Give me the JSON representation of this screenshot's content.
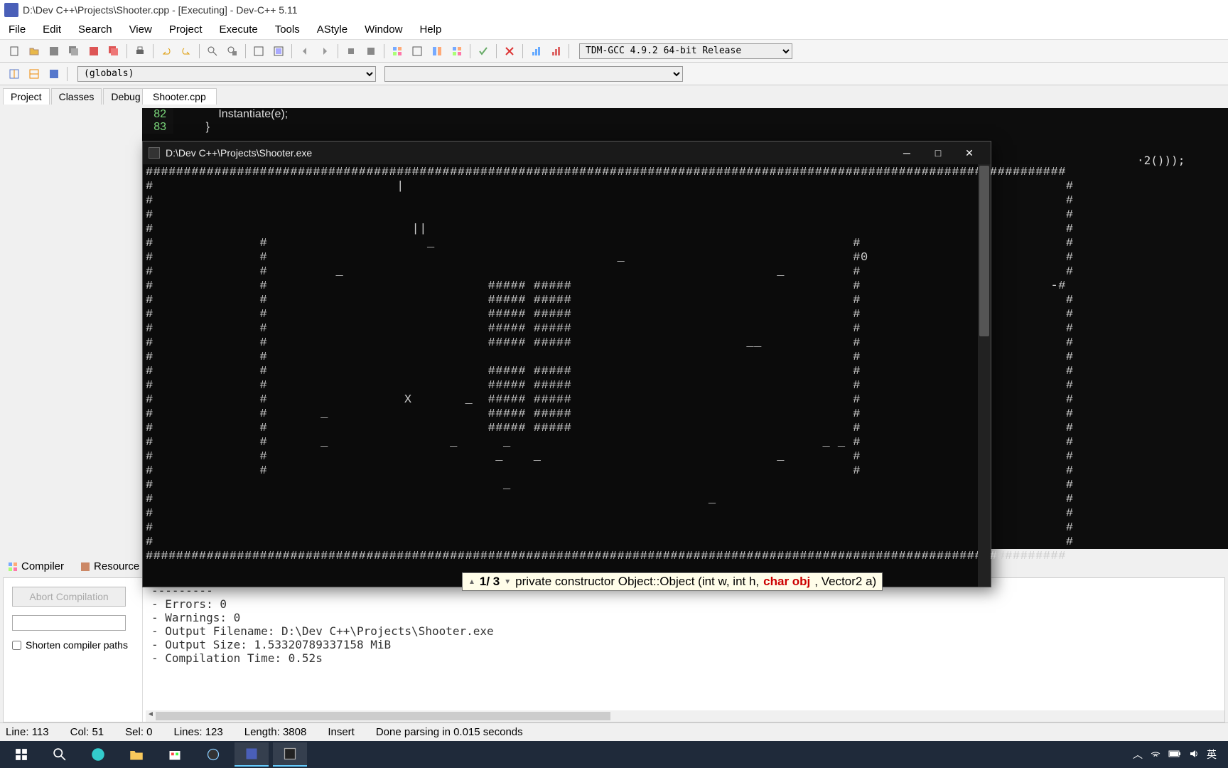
{
  "window_title": "D:\\Dev C++\\Projects\\Shooter.cpp - [Executing] - Dev-C++ 5.11",
  "menu": [
    "File",
    "Edit",
    "Search",
    "View",
    "Project",
    "Execute",
    "Tools",
    "AStyle",
    "Window",
    "Help"
  ],
  "compiler_select": "TDM-GCC 4.9.2 64-bit Release",
  "globals_select": "(globals)",
  "side_tabs": [
    "Project",
    "Classes",
    "Debug"
  ],
  "file_tab": "Shooter.cpp",
  "editor_lines": [
    {
      "num": "82",
      "code": "            Instantiate(e);"
    },
    {
      "num": "83",
      "code": "        }"
    }
  ],
  "extra_code": "·2()));",
  "console_title": "D:\\Dev C++\\Projects\\Shooter.exe",
  "console_body": "#########################################################################################################################\n#                                |                                                                                       #\n#                                                                                                                        #\n#                                                                                                                        #\n#                                  ||                                                                                    #\n#              #                     _                                                       #                           #\n#              #                                              _                              #0                          #\n#              #         _                                                         _         #                           #\n#              #                             ##### #####                                     #                         -#\n#              #                             ##### #####                                     #                           #\n#              #                             ##### #####                                     #                           #\n#              #                             ##### #####                                     #                           #\n#              #                             ##### #####                       __            #                           #\n#              #                                                                             #                           #\n#              #                             ##### #####                                     #                           #\n#              #                             ##### #####                                     #                           #\n#              #                  X       _  ##### #####                                     #                           #\n#              #       _                     ##### #####                                     #                           #\n#              #                             ##### #####                                     #                           #\n#              #       _                _      _                                         _ _ #                           #\n#              #                              _    _                               _         #                           #\n#              #                                                                             #                           #\n#                                              _                                                                         #\n#                                                                         _                                              #\n#                                                                                                                        #\n#                                                                                                                        #\n#                                                                                                                        #\n#########################################################################################################################",
  "tooltip": {
    "pos": "1/ 3",
    "text1": "private constructor Object::Object (int w, int h, ",
    "red": "char obj",
    "text2": ", Vector2 a)"
  },
  "bottom_tabs": [
    "Compiler",
    "Resource"
  ],
  "abort_label": "Abort Compilation",
  "shorten_label": "Shorten compiler paths",
  "compile_log": "---------\n- Errors: 0\n- Warnings: 0\n- Output Filename: D:\\Dev C++\\Projects\\Shooter.exe\n- Output Size: 1.53320789337158 MiB\n- Compilation Time: 0.52s",
  "status": {
    "line": "Line:  113",
    "col": "Col:  51",
    "sel": "Sel:  0",
    "lines": "Lines:  123",
    "length": "Length:  3808",
    "mode": "Insert",
    "parse": "Done parsing in 0.015 seconds"
  },
  "tray": {
    "ime": "英"
  }
}
